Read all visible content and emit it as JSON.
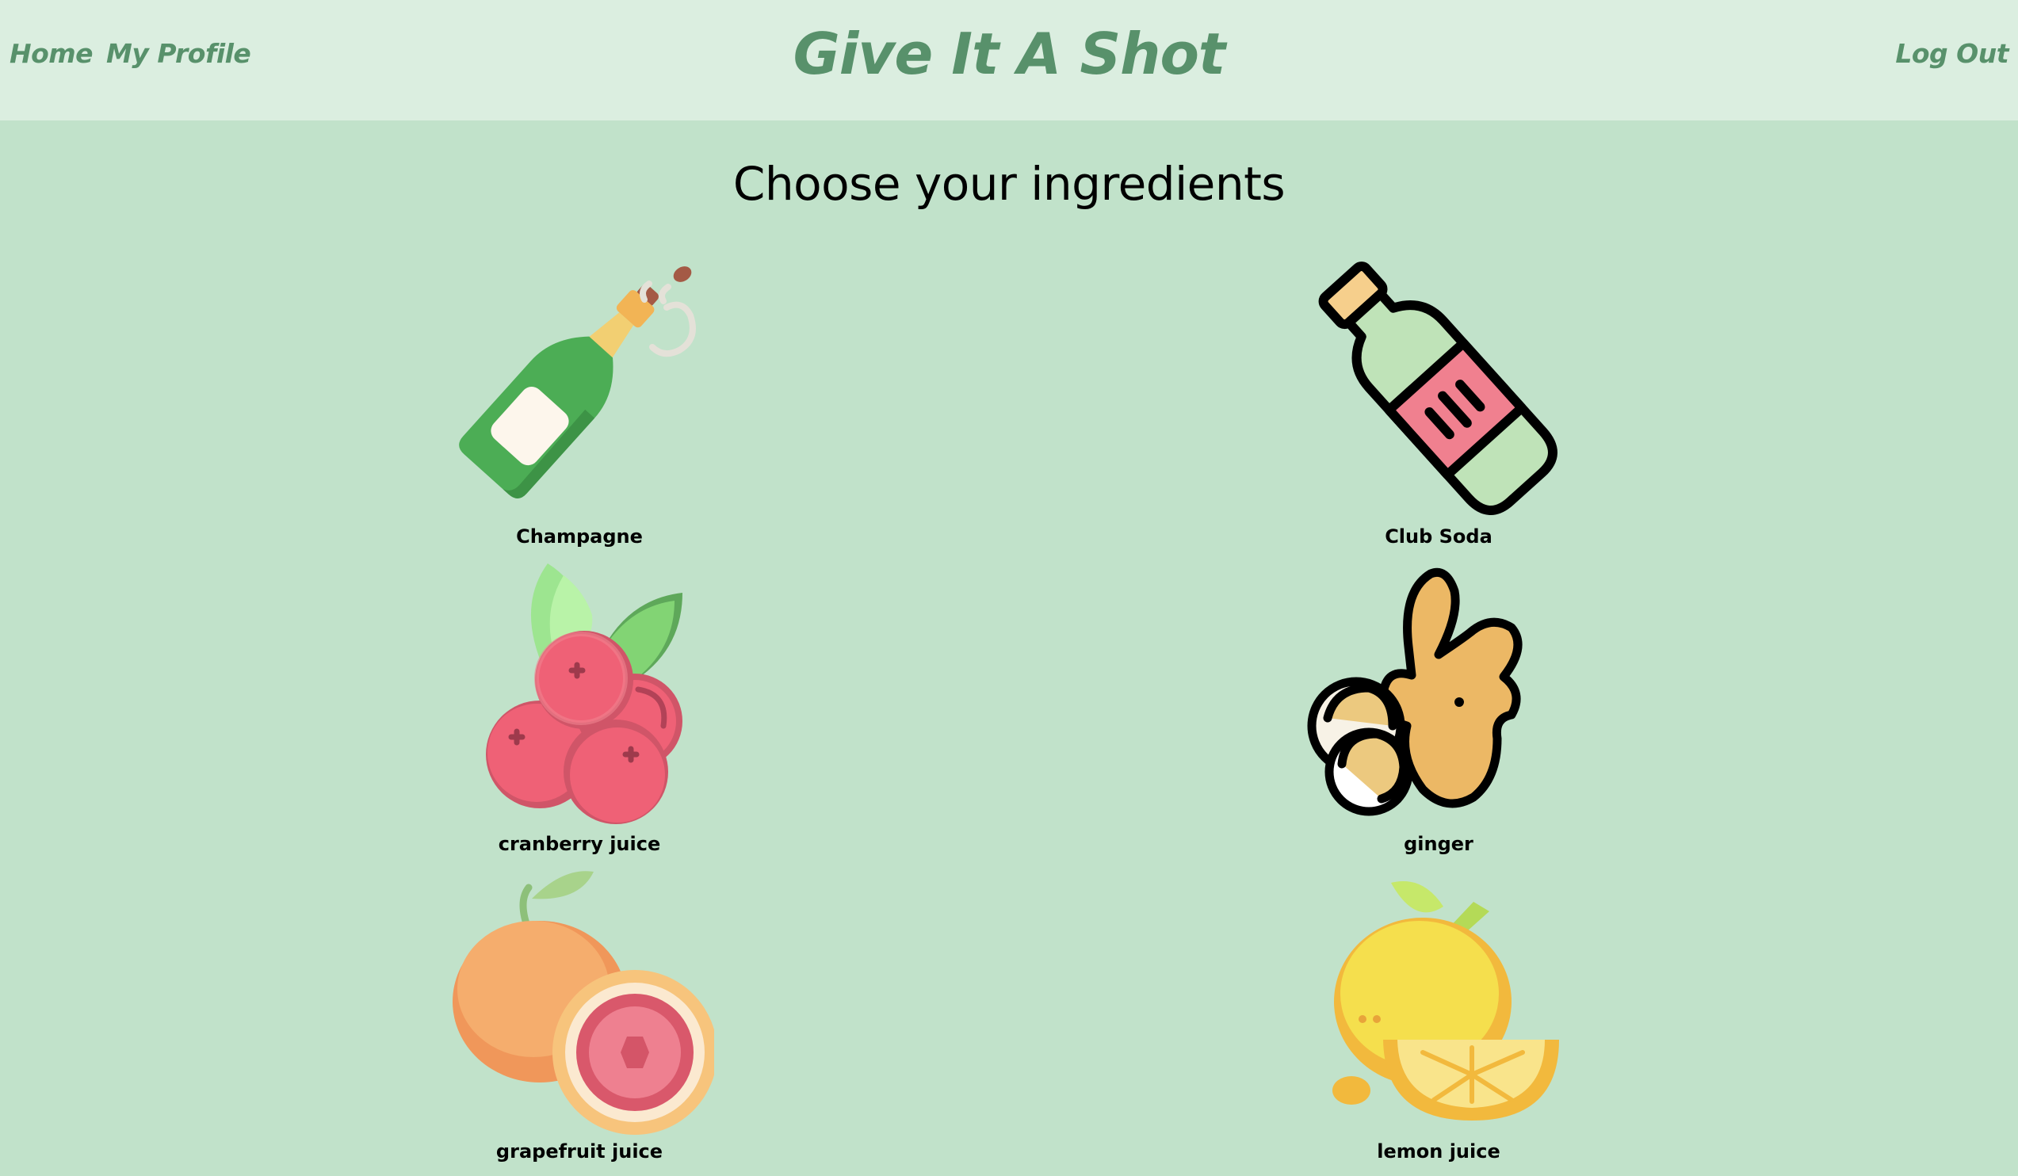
{
  "nav": {
    "home": "Home",
    "profile": "My Profile",
    "brand": "Give It A Shot",
    "logout": "Log Out"
  },
  "main": {
    "heading": "Choose your ingredients",
    "ingredients": [
      {
        "label": "Champagne",
        "icon": "champagne-icon"
      },
      {
        "label": "Club Soda",
        "icon": "club-soda-icon"
      },
      {
        "label": "cranberry juice",
        "icon": "cranberry-icon"
      },
      {
        "label": "ginger",
        "icon": "ginger-icon"
      },
      {
        "label": "grapefruit juice",
        "icon": "grapefruit-icon"
      },
      {
        "label": "lemon juice",
        "icon": "lemon-icon"
      }
    ]
  },
  "colors": {
    "background": "#c1e2ca",
    "navbar": "#dbeee0",
    "accent": "#58916b"
  }
}
